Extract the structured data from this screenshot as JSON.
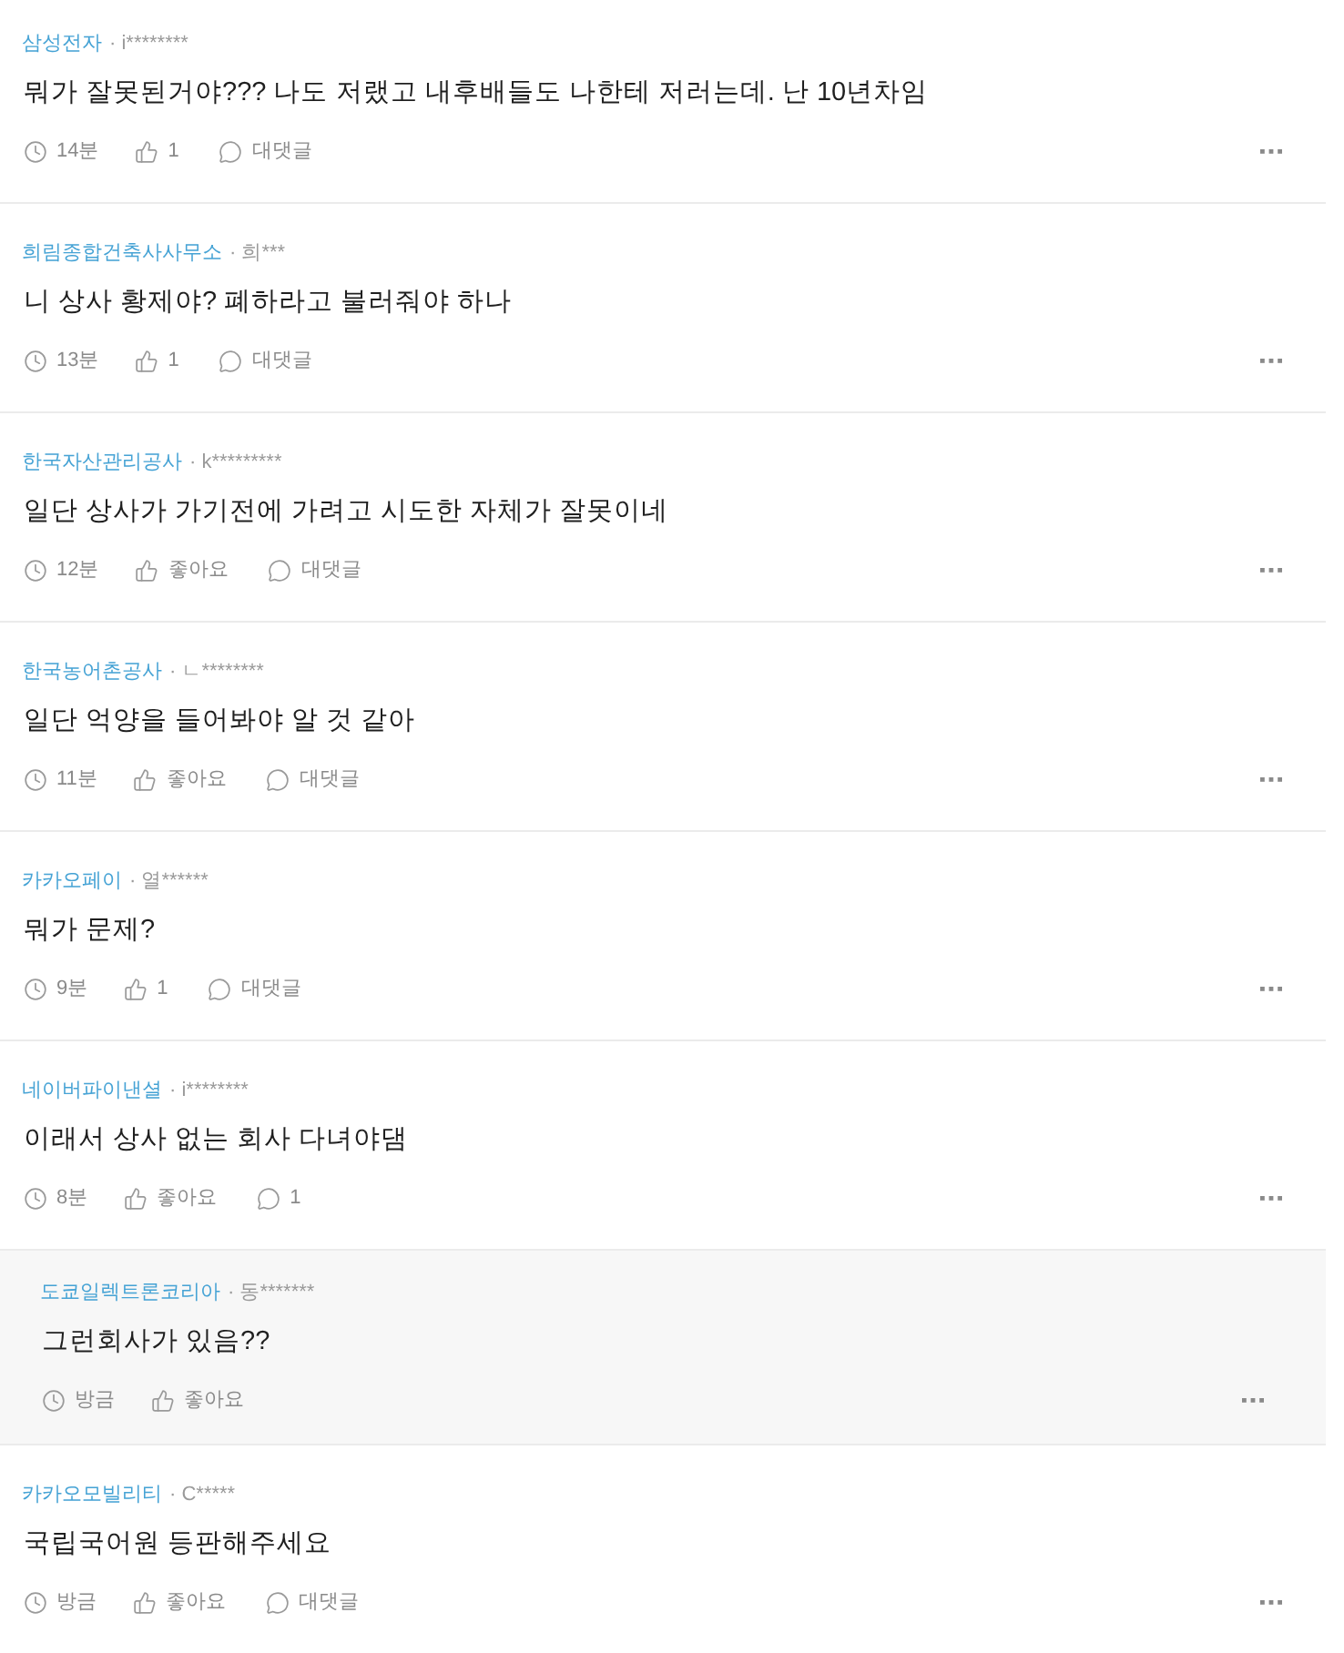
{
  "comments": [
    {
      "kind": "comment",
      "company": "삼성전자",
      "author": "· i********",
      "text": "뭐가 잘못된거야??? 나도 저랬고 내후배들도 나한테 저러는데. 난 10년차임",
      "time": "14분",
      "like": "1",
      "reply": "대댓글"
    },
    {
      "kind": "comment",
      "company": "희림종합건축사사무소",
      "author": "· 희***",
      "text": "니 상사 황제야? 폐하라고 불러줘야 하나",
      "time": "13분",
      "like": "1",
      "reply": "대댓글"
    },
    {
      "kind": "comment",
      "company": "한국자산관리공사",
      "author": "· k*********",
      "text": "일단 상사가 가기전에 가려고 시도한 자체가 잘못이네",
      "time": "12분",
      "like": "좋아요",
      "reply": "대댓글"
    },
    {
      "kind": "comment",
      "company": "한국농어촌공사",
      "author": "· ㄴ********",
      "text": "일단 억양을 들어봐야 알 것 같아",
      "time": "11분",
      "like": "좋아요",
      "reply": "대댓글"
    },
    {
      "kind": "comment",
      "company": "카카오페이",
      "author": "· 열******",
      "text": "뭐가 문제?",
      "time": "9분",
      "like": "1",
      "reply": "대댓글"
    },
    {
      "kind": "comment",
      "company": "네이버파이낸셜",
      "author": "· i********",
      "text": "이래서 상사 없는 회사 다녀야댐",
      "time": "8분",
      "like": "좋아요",
      "reply": "1"
    },
    {
      "kind": "reply",
      "company": "도쿄일렉트론코리아",
      "author": "· 동*******",
      "text": "그런회사가 있음??",
      "time": "방금",
      "like": "좋아요"
    },
    {
      "kind": "comment",
      "company": "카카오모빌리티",
      "author": "· C*****",
      "text": "국립국어원 등판해주세요",
      "time": "방금",
      "like": "좋아요",
      "reply": "대댓글"
    }
  ]
}
